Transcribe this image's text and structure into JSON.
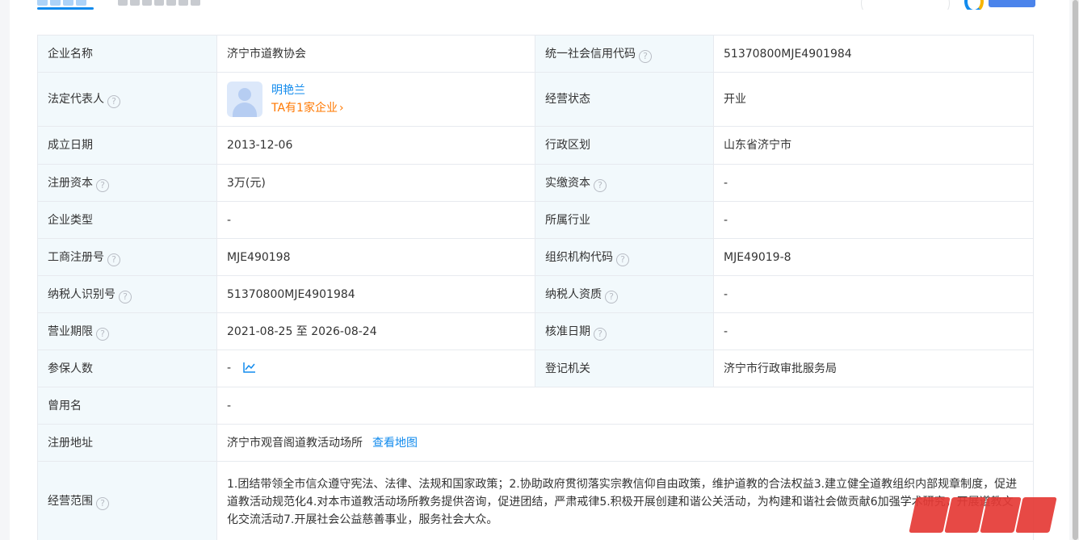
{
  "rows": [
    {
      "l1": "企业名称",
      "v1": "济宁市道教协会",
      "l2": "统一社会信用代码",
      "v2": "51370800MJE4901984"
    },
    {
      "l1": "法定代表人",
      "person_name": "明艳兰",
      "person_link": "TA有1家企业",
      "l2": "经营状态",
      "v2": "开业"
    },
    {
      "l1": "成立日期",
      "v1": "2013-12-06",
      "l2": "行政区划",
      "v2": "山东省济宁市"
    },
    {
      "l1": "注册资本",
      "v1": "3万(元)",
      "l2": "实缴资本",
      "v2": "-"
    },
    {
      "l1": "企业类型",
      "v1": "-",
      "l2": "所属行业",
      "v2": "-"
    },
    {
      "l1": "工商注册号",
      "v1": "MJE490198",
      "l2": "组织机构代码",
      "v2": "MJE49019-8"
    },
    {
      "l1": "纳税人识别号",
      "v1": "51370800MJE4901984",
      "l2": "纳税人资质",
      "v2": "-"
    },
    {
      "l1": "营业期限",
      "v1": "2021-08-25 至 2026-08-24",
      "l2": "核准日期",
      "v2": "-"
    },
    {
      "l1": "参保人数",
      "v1": "-",
      "l2": "登记机关",
      "v2": "济宁市行政审批服务局"
    },
    {
      "l1": "曾用名",
      "v1": "-"
    },
    {
      "l1": "注册地址",
      "v1": "济宁市观音阁道教活动场所",
      "link": "查看地图"
    },
    {
      "l1": "经营范围",
      "v1": "1.团结带领全市信众遵守宪法、法律、法规和国家政策；2.协助政府贯彻落实宗教信仰自由政策，维护道教的合法权益3.建立健全道教组织内部规章制度，促进道教活动规范化4.对本市道教活动场所教务提供咨询，促进团结，严肃戒律5.积极开展创建和谐公关活动，为构建和谐社会做贡献6加强学术研究，开展道教文化交流活动7.开展社会公益慈善事业，服务社会大众。"
    }
  ],
  "help_glyph": "?",
  "chevron_glyph": "›",
  "colors": {
    "accent": "#128bed",
    "label_bg": "#f2f9fc",
    "border": "#e7eaef",
    "link_orange": "#ff7800"
  }
}
